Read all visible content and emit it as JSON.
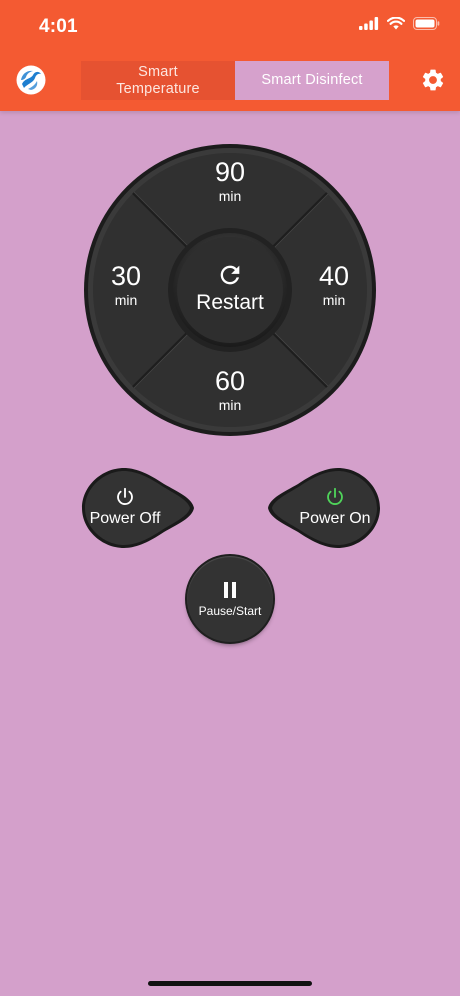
{
  "status_bar": {
    "time": "4:01",
    "icons": [
      "cellular-icon",
      "wifi-icon",
      "battery-icon"
    ]
  },
  "header": {
    "logo_icon": "swirl-logo-icon",
    "tabs": [
      {
        "label": "Smart\nTemperature",
        "active": false
      },
      {
        "label": "Smart Disinfect",
        "active": true
      }
    ],
    "settings_icon": "gear-icon"
  },
  "dial": {
    "top": {
      "value": "90",
      "unit": "min"
    },
    "left": {
      "value": "30",
      "unit": "min"
    },
    "right": {
      "value": "40",
      "unit": "min"
    },
    "bottom": {
      "value": "60",
      "unit": "min"
    },
    "center": {
      "icon": "refresh-icon",
      "label": "Restart"
    }
  },
  "controls": {
    "power_off": {
      "label": "Power Off",
      "icon": "power-icon"
    },
    "power_on": {
      "label": "Power On",
      "icon": "power-icon"
    },
    "pause_start": {
      "label": "Pause/Start",
      "icon": "pause-icon"
    }
  },
  "colors": {
    "header_bg": "#f45a32",
    "tab_inactive_bg": "#e65231",
    "tab_active_bg": "#d6a1cc",
    "page_bg": "#d4a0cb",
    "button_bg": "#333333",
    "power_on_icon": "#4fd35a"
  }
}
